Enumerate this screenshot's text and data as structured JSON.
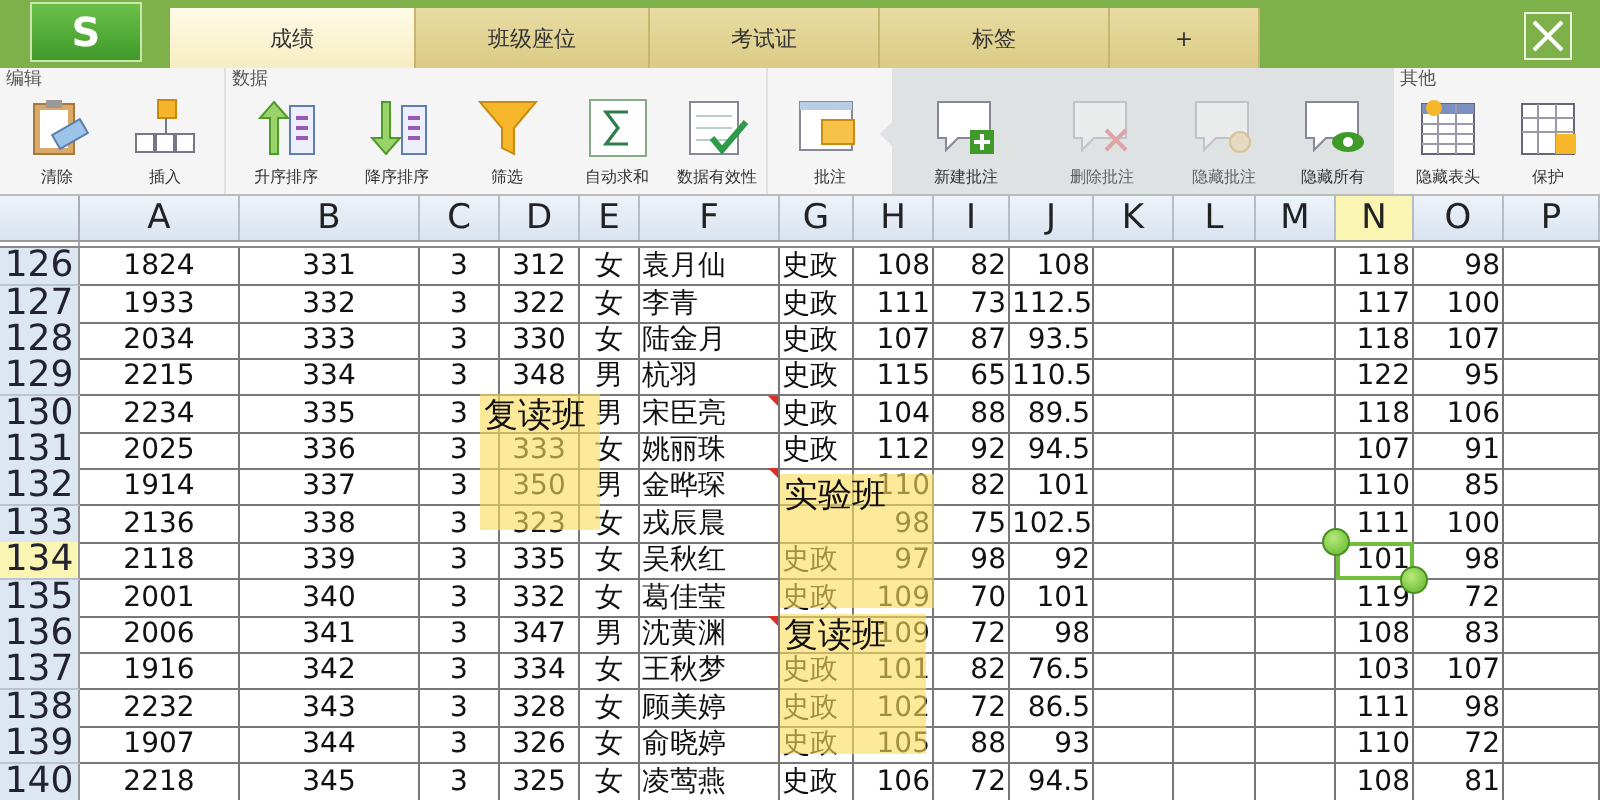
{
  "app": {
    "logo": "S"
  },
  "tabs": [
    {
      "label": "成绩",
      "selected": true
    },
    {
      "label": "班级座位",
      "selected": false
    },
    {
      "label": "考试证",
      "selected": false
    },
    {
      "label": "标签",
      "selected": false
    },
    {
      "label": "+",
      "selected": false
    }
  ],
  "ribbon": {
    "groups": [
      {
        "label": "编辑",
        "items": [
          {
            "label": "清除",
            "disabled": false
          },
          {
            "label": "插入",
            "disabled": false
          }
        ]
      },
      {
        "label": "数据",
        "items": [
          {
            "label": "升序排序",
            "disabled": false
          },
          {
            "label": "降序排序",
            "disabled": false
          },
          {
            "label": "筛选",
            "disabled": false
          },
          {
            "label": "自动求和",
            "disabled": false
          },
          {
            "label": "数据有效性",
            "disabled": false
          }
        ]
      },
      {
        "items": [
          {
            "label": "批注",
            "disabled": false
          }
        ]
      },
      {
        "popout": true,
        "items": [
          {
            "label": "新建批注",
            "disabled": false
          },
          {
            "label": "删除批注",
            "disabled": true
          },
          {
            "label": "隐藏批注",
            "disabled": true
          },
          {
            "label": "隐藏所有",
            "disabled": false
          }
        ]
      },
      {
        "label": "其他",
        "items": [
          {
            "label": "隐藏表头",
            "disabled": false
          },
          {
            "label": "保护",
            "disabled": false
          }
        ]
      }
    ]
  },
  "columns": [
    {
      "label": "A",
      "selected": false
    },
    {
      "label": "B",
      "selected": false
    },
    {
      "label": "C",
      "selected": false
    },
    {
      "label": "D",
      "selected": false
    },
    {
      "label": "E",
      "selected": false
    },
    {
      "label": "F",
      "selected": false
    },
    {
      "label": "G",
      "selected": false
    },
    {
      "label": "H",
      "selected": false
    },
    {
      "label": "I",
      "selected": false
    },
    {
      "label": "J",
      "selected": false
    },
    {
      "label": "K",
      "selected": false
    },
    {
      "label": "L",
      "selected": false
    },
    {
      "label": "M",
      "selected": false
    },
    {
      "label": "N",
      "selected": true
    },
    {
      "label": "O",
      "selected": false
    },
    {
      "label": "P",
      "selected": false
    }
  ],
  "rows": [
    {
      "header": "126",
      "selected": false,
      "cells": [
        "1824",
        "331",
        "3",
        "312",
        "女",
        "袁月仙",
        "史政",
        "108",
        "82",
        "108",
        null,
        null,
        null,
        "118",
        "98",
        null
      ]
    },
    {
      "header": "127",
      "selected": false,
      "cells": [
        "1933",
        "332",
        "3",
        "322",
        "女",
        "李青",
        "史政",
        "111",
        "73",
        "112.5",
        null,
        null,
        null,
        "117",
        "100",
        null
      ]
    },
    {
      "header": "128",
      "selected": false,
      "cells": [
        "2034",
        "333",
        "3",
        "330",
        "女",
        "陆金月",
        "史政",
        "107",
        "87",
        "93.5",
        null,
        null,
        null,
        "118",
        "107",
        null
      ]
    },
    {
      "header": "129",
      "selected": false,
      "cells": [
        "2215",
        "334",
        "3",
        "348",
        "男",
        "杭羽",
        "史政",
        "115",
        "65",
        "110.5",
        null,
        null,
        null,
        "122",
        "95",
        null
      ]
    },
    {
      "header": "130",
      "selected": false,
      "cells": [
        "2234",
        "335",
        "3",
        null,
        "男",
        {
          "value": "宋臣亮",
          "comment": "复读班"
        },
        "史政",
        "104",
        "88",
        "89.5",
        null,
        null,
        null,
        "118",
        "106",
        null
      ]
    },
    {
      "header": "131",
      "selected": false,
      "cells": [
        "2025",
        "336",
        "3",
        "333",
        "女",
        "姚丽珠",
        "史政",
        "112",
        "92",
        "94.5",
        null,
        null,
        null,
        "107",
        "91",
        null
      ]
    },
    {
      "header": "132",
      "selected": false,
      "cells": [
        "1914",
        "337",
        "3",
        "350",
        "男",
        {
          "value": "金晔琛",
          "comment": "实验班"
        },
        null,
        "110",
        "82",
        "101",
        null,
        null,
        null,
        "110",
        "85",
        null
      ]
    },
    {
      "header": "133",
      "selected": false,
      "cells": [
        "2136",
        "338",
        "3",
        "323",
        "女",
        "戎辰晨",
        null,
        "98",
        "75",
        "102.5",
        null,
        null,
        null,
        "111",
        "100",
        null
      ]
    },
    {
      "header": "134",
      "selected": true,
      "cells": [
        "2118",
        "339",
        "3",
        "335",
        "女",
        "吴秋红",
        "史政",
        "97",
        "98",
        "92",
        null,
        null,
        null,
        "101",
        "98",
        null
      ]
    },
    {
      "header": "135",
      "selected": false,
      "cells": [
        "2001",
        "340",
        "3",
        "332",
        "女",
        "葛佳莹",
        "史政",
        "109",
        "70",
        "101",
        null,
        null,
        null,
        "119",
        "72",
        null
      ]
    },
    {
      "header": "136",
      "selected": false,
      "cells": [
        "2006",
        "341",
        "3",
        "347",
        "男",
        {
          "value": "沈黄渊",
          "comment": "复读班"
        },
        null,
        "109",
        "72",
        "98",
        null,
        null,
        null,
        "108",
        "83",
        null
      ]
    },
    {
      "header": "137",
      "selected": false,
      "cells": [
        "1916",
        "342",
        "3",
        "334",
        "女",
        "王秋梦",
        "史政",
        "101",
        "82",
        "76.5",
        null,
        null,
        null,
        "103",
        "107",
        null
      ]
    },
    {
      "header": "138",
      "selected": false,
      "cells": [
        "2232",
        "343",
        "3",
        "328",
        "女",
        "顾美婷",
        "史政",
        "102",
        "72",
        "86.5",
        null,
        null,
        null,
        "111",
        "98",
        null
      ]
    },
    {
      "header": "139",
      "selected": false,
      "cells": [
        "1907",
        "344",
        "3",
        "326",
        "女",
        "俞晓婷",
        "史政",
        "105",
        "88",
        "93",
        null,
        null,
        null,
        "110",
        "72",
        null
      ]
    },
    {
      "header": "140",
      "selected": false,
      "cells": [
        "2218",
        "345",
        "3",
        "325",
        "女",
        "凌莺燕",
        "史政",
        "106",
        "72",
        "94.5",
        null,
        null,
        null,
        "108",
        "81",
        null
      ]
    }
  ]
}
